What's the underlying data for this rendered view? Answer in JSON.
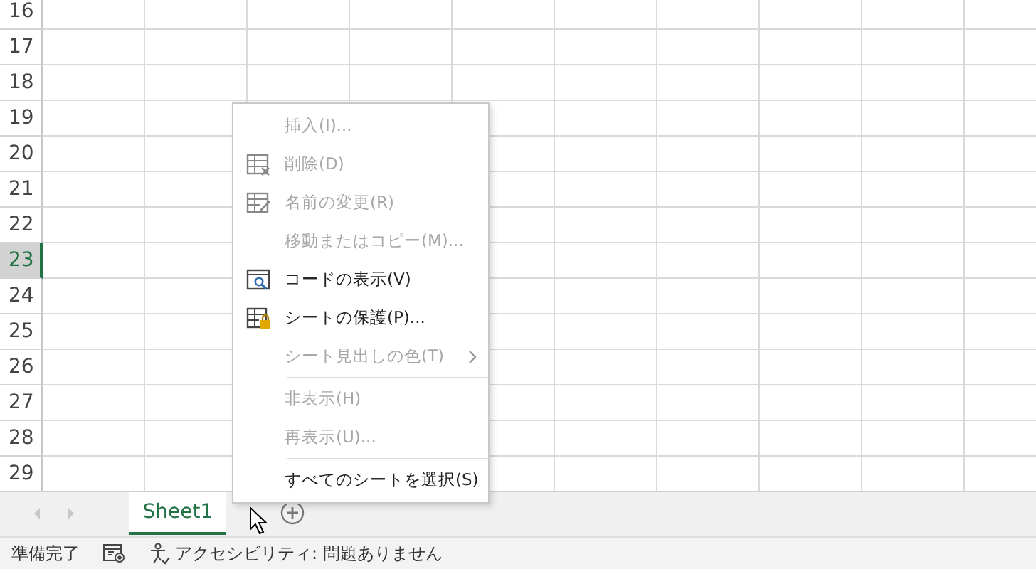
{
  "grid": {
    "rows": [
      {
        "label": "16",
        "selected": false
      },
      {
        "label": "17",
        "selected": false
      },
      {
        "label": "18",
        "selected": false
      },
      {
        "label": "19",
        "selected": false
      },
      {
        "label": "20",
        "selected": false
      },
      {
        "label": "21",
        "selected": false
      },
      {
        "label": "22",
        "selected": false
      },
      {
        "label": "23",
        "selected": true
      },
      {
        "label": "24",
        "selected": false
      },
      {
        "label": "25",
        "selected": false
      },
      {
        "label": "26",
        "selected": false
      },
      {
        "label": "27",
        "selected": false
      },
      {
        "label": "28",
        "selected": false
      },
      {
        "label": "29",
        "selected": false
      }
    ]
  },
  "context_menu": {
    "items": [
      {
        "kind": "item",
        "label": "挿入(I)...",
        "disabled": true
      },
      {
        "kind": "item",
        "label": "削除(D)",
        "disabled": true
      },
      {
        "kind": "item",
        "label": "名前の変更(R)",
        "disabled": true
      },
      {
        "kind": "item",
        "label": "移動またはコピー(M)...",
        "disabled": true
      },
      {
        "kind": "item",
        "label": "コードの表示(V)",
        "disabled": false
      },
      {
        "kind": "item",
        "label": "シートの保護(P)...",
        "disabled": false
      },
      {
        "kind": "submenu",
        "label": "シート見出しの色(T)",
        "disabled": true
      },
      {
        "kind": "separator"
      },
      {
        "kind": "item",
        "label": "非表示(H)",
        "disabled": true
      },
      {
        "kind": "item",
        "label": "再表示(U)...",
        "disabled": true
      },
      {
        "kind": "separator"
      },
      {
        "kind": "item",
        "label": "すべてのシートを選択(S)",
        "disabled": false
      }
    ]
  },
  "sheet_tabs": [
    {
      "label": "Sheet1",
      "selected": true
    }
  ],
  "status_bar": {
    "mode": "準備完了",
    "accessibility": "アクセシビリティ: 問題ありません"
  }
}
